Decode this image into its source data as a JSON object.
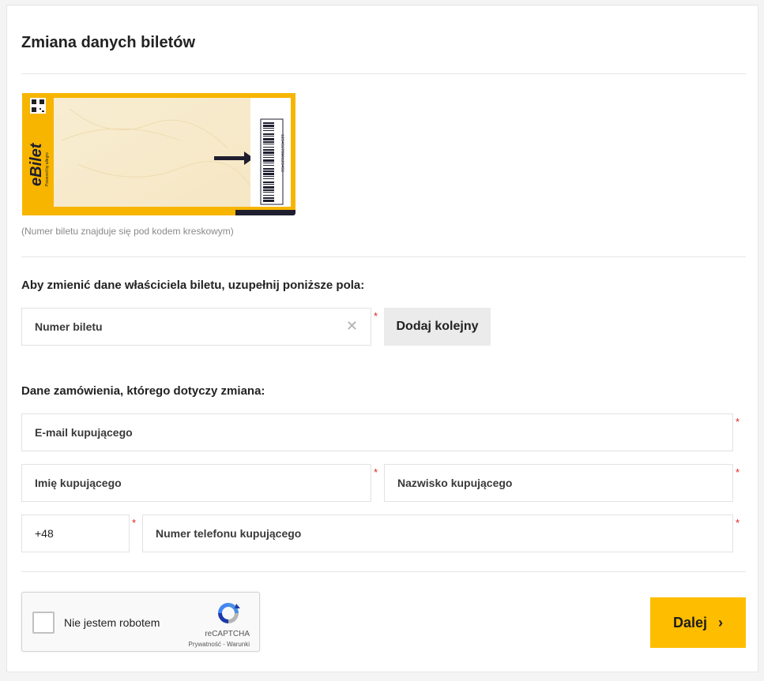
{
  "page_title": "Zmiana danych biletów",
  "ticket_image": {
    "brand": "eBilet",
    "powered_by": "Powered by allegro",
    "barcode_number": "1234567890123456",
    "caption": "(Numer biletu znajduje się pod kodem kreskowym)"
  },
  "ticket_section": {
    "heading": "Aby zmienić dane właściciela biletu, uzupełnij poniższe pola:",
    "ticket_number_label": "Numer biletu",
    "clear_symbol": "✕",
    "add_button": "Dodaj kolejny"
  },
  "order_section": {
    "heading": "Dane zamówienia, którego dotyczy zmiana:",
    "email_label": "E-mail kupującego",
    "first_name_label": "Imię kupującego",
    "last_name_label": "Nazwisko kupującego",
    "phone_prefix": "+48",
    "phone_label": "Numer telefonu kupującego"
  },
  "required_marker": "*",
  "captcha": {
    "label": "Nie jestem robotem",
    "brand": "reCAPTCHA",
    "terms": "Prywatność - Warunki"
  },
  "next_button": {
    "label": "Dalej",
    "chevron": "›"
  },
  "colors": {
    "accent": "#ffbd00",
    "ticket_yellow": "#f7b500",
    "ticket_dark": "#1e1e2e",
    "required": "#dd2222"
  }
}
